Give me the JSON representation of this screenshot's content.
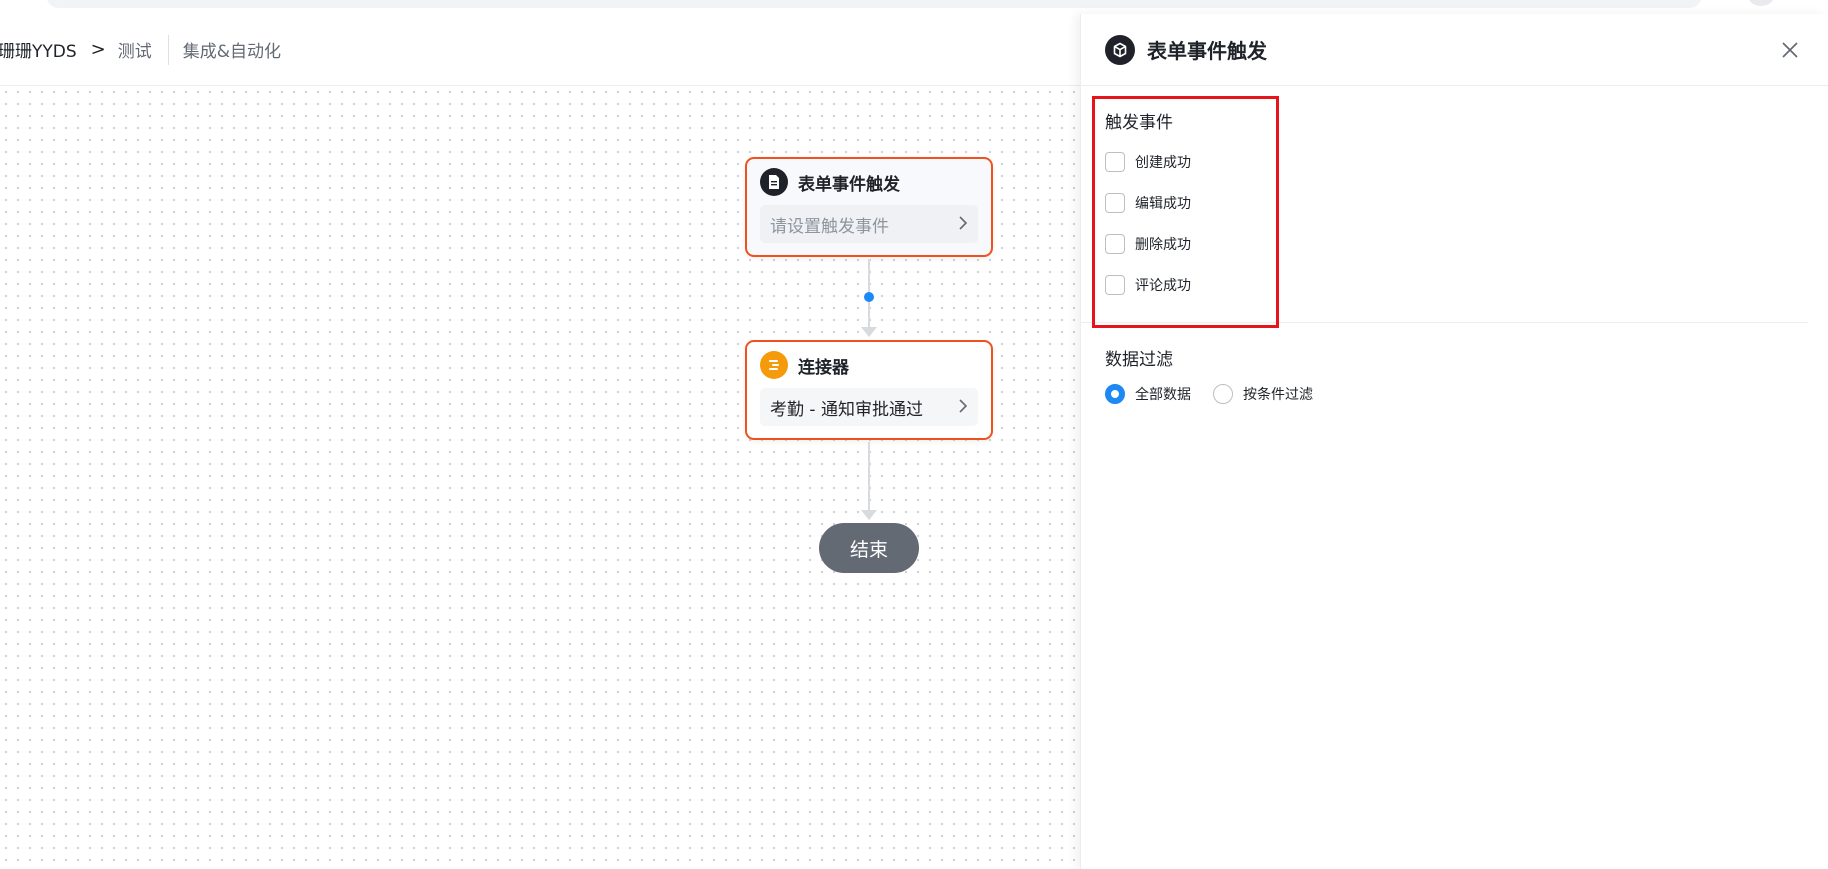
{
  "header": {
    "breadcrumb_root": "珊珊YYDS",
    "breadcrumb_sep": ">",
    "breadcrumb_current": "测试",
    "tab_label": "集成&自动化"
  },
  "flow": {
    "trigger_node": {
      "title": "表单事件触发",
      "subtitle": "请设置触发事件"
    },
    "connector_node": {
      "title": "连接器",
      "subtitle": "考勤 - 通知审批通过"
    },
    "end_node": {
      "label": "结束"
    }
  },
  "panel": {
    "title": "表单事件触发",
    "trigger_events": {
      "title": "触发事件",
      "options": [
        "创建成功",
        "编辑成功",
        "删除成功",
        "评论成功"
      ]
    },
    "data_filter": {
      "title": "数据过滤",
      "options": [
        "全部数据",
        "按条件过滤"
      ],
      "selected": "全部数据"
    }
  },
  "colors": {
    "node_border": "#f0521f",
    "accent_blue": "#1e88f5",
    "highlight_red": "#e8141b",
    "connector_icon": "#f59a0b"
  }
}
